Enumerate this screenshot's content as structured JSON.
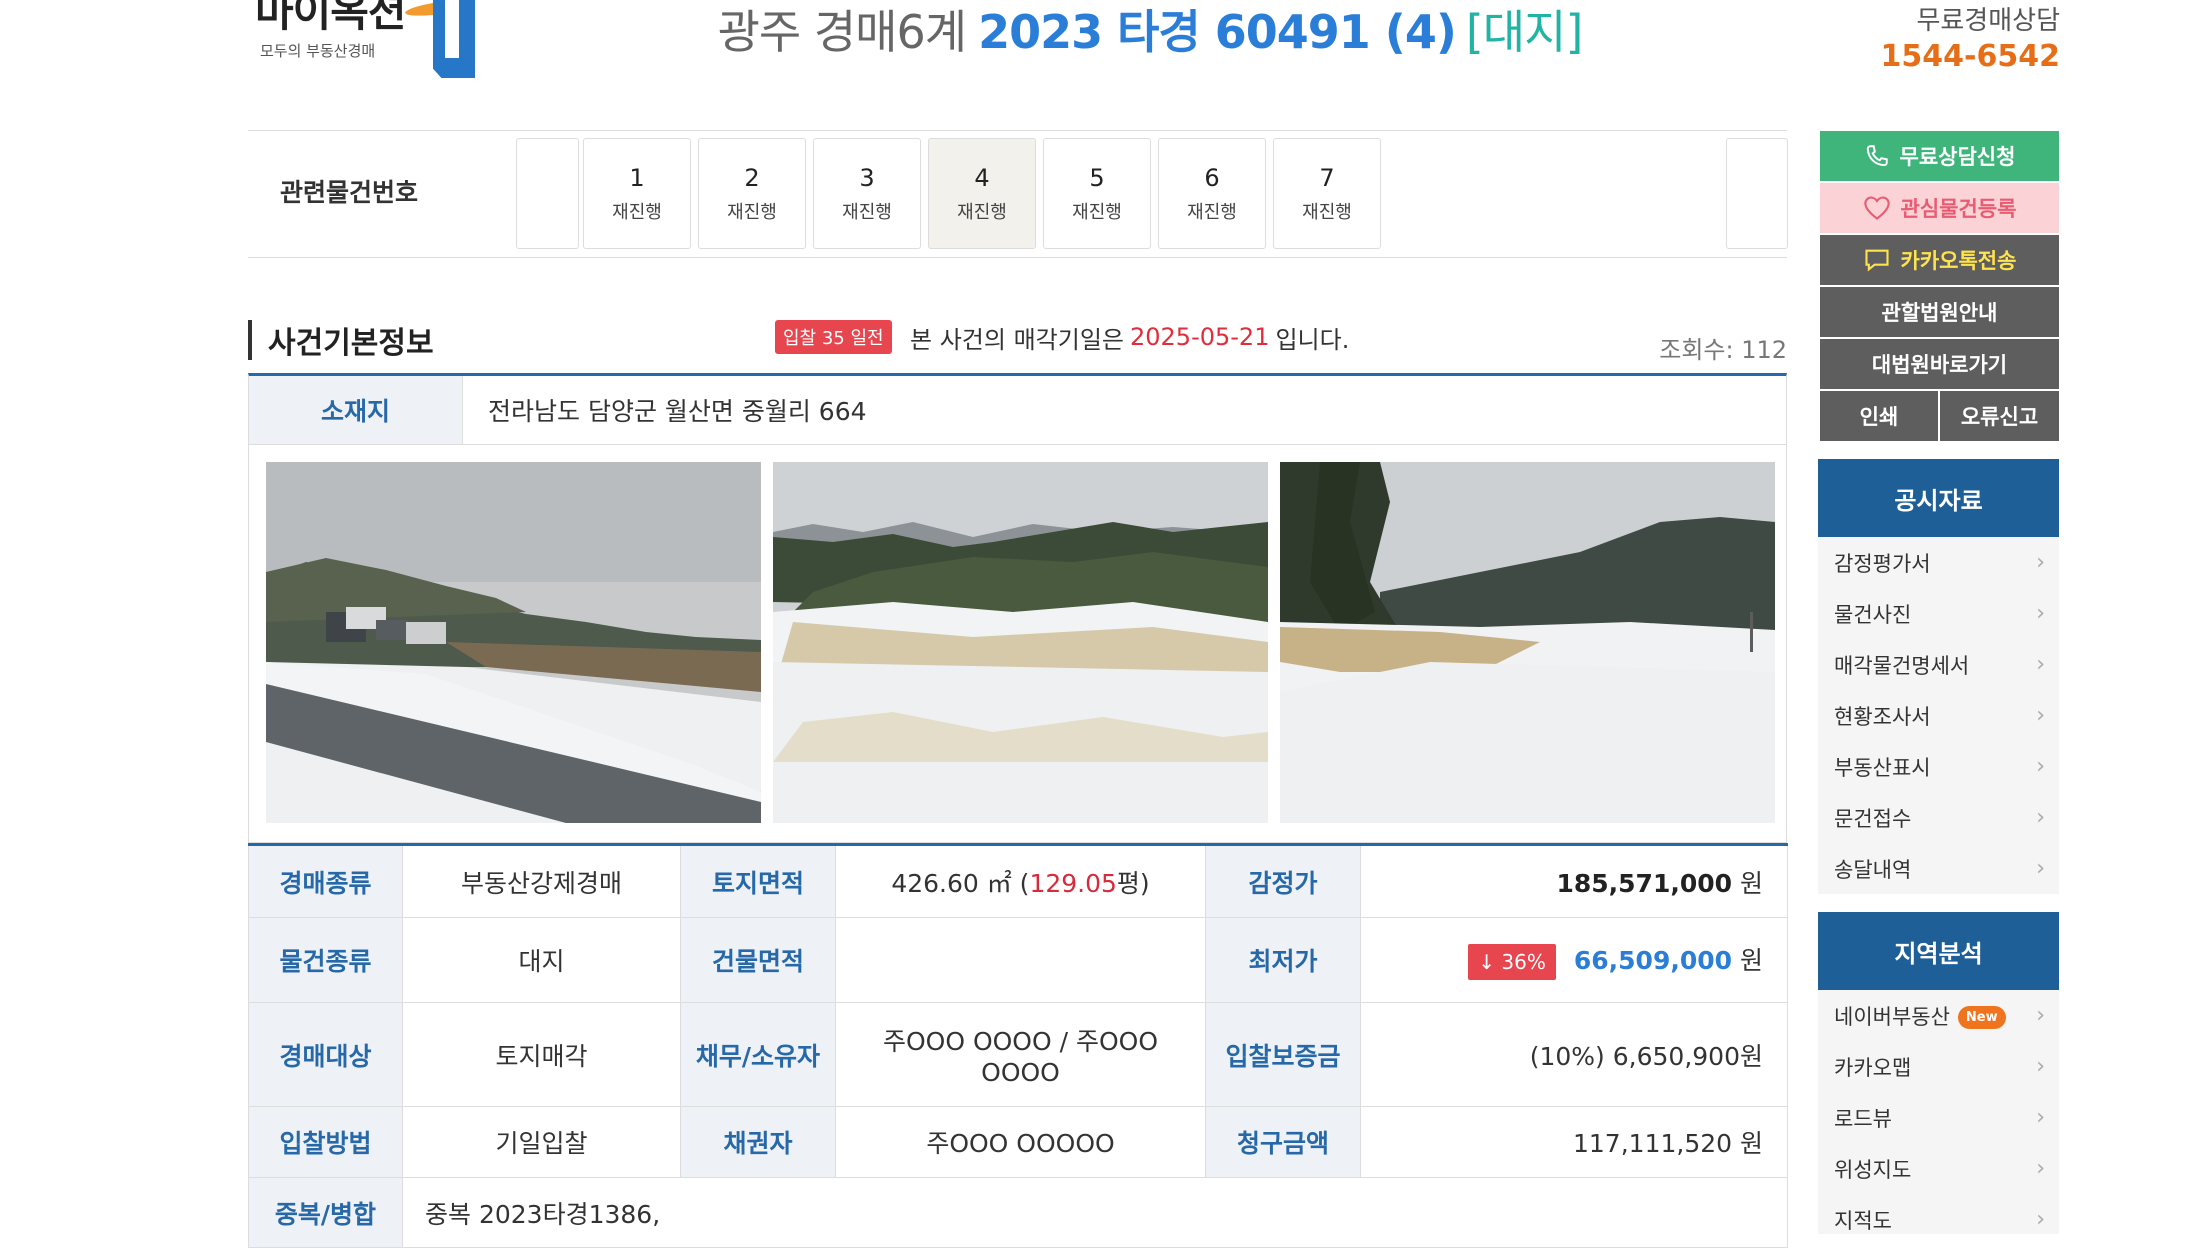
{
  "header": {
    "logo_text": "마이옥션",
    "logo_sub": "모두의 부동산경매",
    "court": "광주 경매6계",
    "case": "2023 타경 60491 (4)",
    "type": "[대지]",
    "consult_label": "무료경매상담",
    "consult_phone": "1544-6542"
  },
  "related": {
    "label": "관련물건번호",
    "items": [
      {
        "num": "1",
        "status": "재진행"
      },
      {
        "num": "2",
        "status": "재진행"
      },
      {
        "num": "3",
        "status": "재진행"
      },
      {
        "num": "4",
        "status": "재진행"
      },
      {
        "num": "5",
        "status": "재진행"
      },
      {
        "num": "6",
        "status": "재진행"
      },
      {
        "num": "7",
        "status": "재진행"
      }
    ],
    "active": "4"
  },
  "section": {
    "title": "사건기본정보",
    "days_badge": "입찰 35 일전",
    "notice_prefix": "본 사건의 매각기일은",
    "sale_date": "2025-05-21",
    "notice_suffix": "입니다.",
    "views": "조회수: 112"
  },
  "location": {
    "label": "소재지",
    "value": "전라남도 담양군 월산면 중월리 664"
  },
  "info": {
    "auction_kind_label": "경매종류",
    "auction_kind": "부동산강제경매",
    "land_area_label": "토지면적",
    "land_area": "426.60 ㎡ (",
    "land_area_pyeong": "129.05",
    "land_area_unit": "평)",
    "appraisal_label": "감정가",
    "appraisal": "185,571,000",
    "won": "원",
    "property_kind_label": "물건종류",
    "property_kind": "대지",
    "building_area_label": "건물면적",
    "building_area": "",
    "min_price_label": "최저가",
    "min_price_pct": "↓ 36%",
    "min_price": "66,509,000",
    "target_label": "경매대상",
    "target": "토지매각",
    "debtor_label": "채무/소유자",
    "debtor": "주OOO OOOO / 주OOO OOOO",
    "deposit_label": "입찰보증금",
    "deposit": "(10%) 6,650,900원",
    "method_label": "입찰방법",
    "method": "기일입찰",
    "creditor_label": "채권자",
    "creditor": "주OOO OOOOO",
    "claim_label": "청구금액",
    "claim": "117,111,520 원",
    "dup_label": "중복/병합",
    "dup": "중복 2023타경1386,"
  },
  "sidebar": {
    "consult_btn": "무료상담신청",
    "fav_btn": "관심물건등록",
    "kakao_btn": "카카오톡전송",
    "court_btn": "관할법원안내",
    "supreme_btn": "대법원바로가기",
    "print_btn": "인쇄",
    "report_btn": "오류신고",
    "public_title": "공시자료",
    "public_items": [
      "감정평가서",
      "물건사진",
      "매각물건명세서",
      "현황조사서",
      "부동산표시",
      "문건접수",
      "송달내역"
    ],
    "region_title": "지역분석",
    "region_items": [
      "네이버부동산",
      "카카오맵",
      "로드뷰",
      "위성지도",
      "지적도"
    ],
    "new_badge": "New"
  },
  "colors": {
    "accent_blue": "#2b7ed8",
    "teal": "#21b3a4",
    "orange": "#e66e18",
    "red": "#d82a3b",
    "panel_navy": "#1f5f97",
    "green": "#3fb57c"
  },
  "icons": {
    "phone": "phone-icon",
    "heart": "heart-icon",
    "chat": "chat-bubble-icon",
    "chevron": "chevron-right-icon"
  }
}
